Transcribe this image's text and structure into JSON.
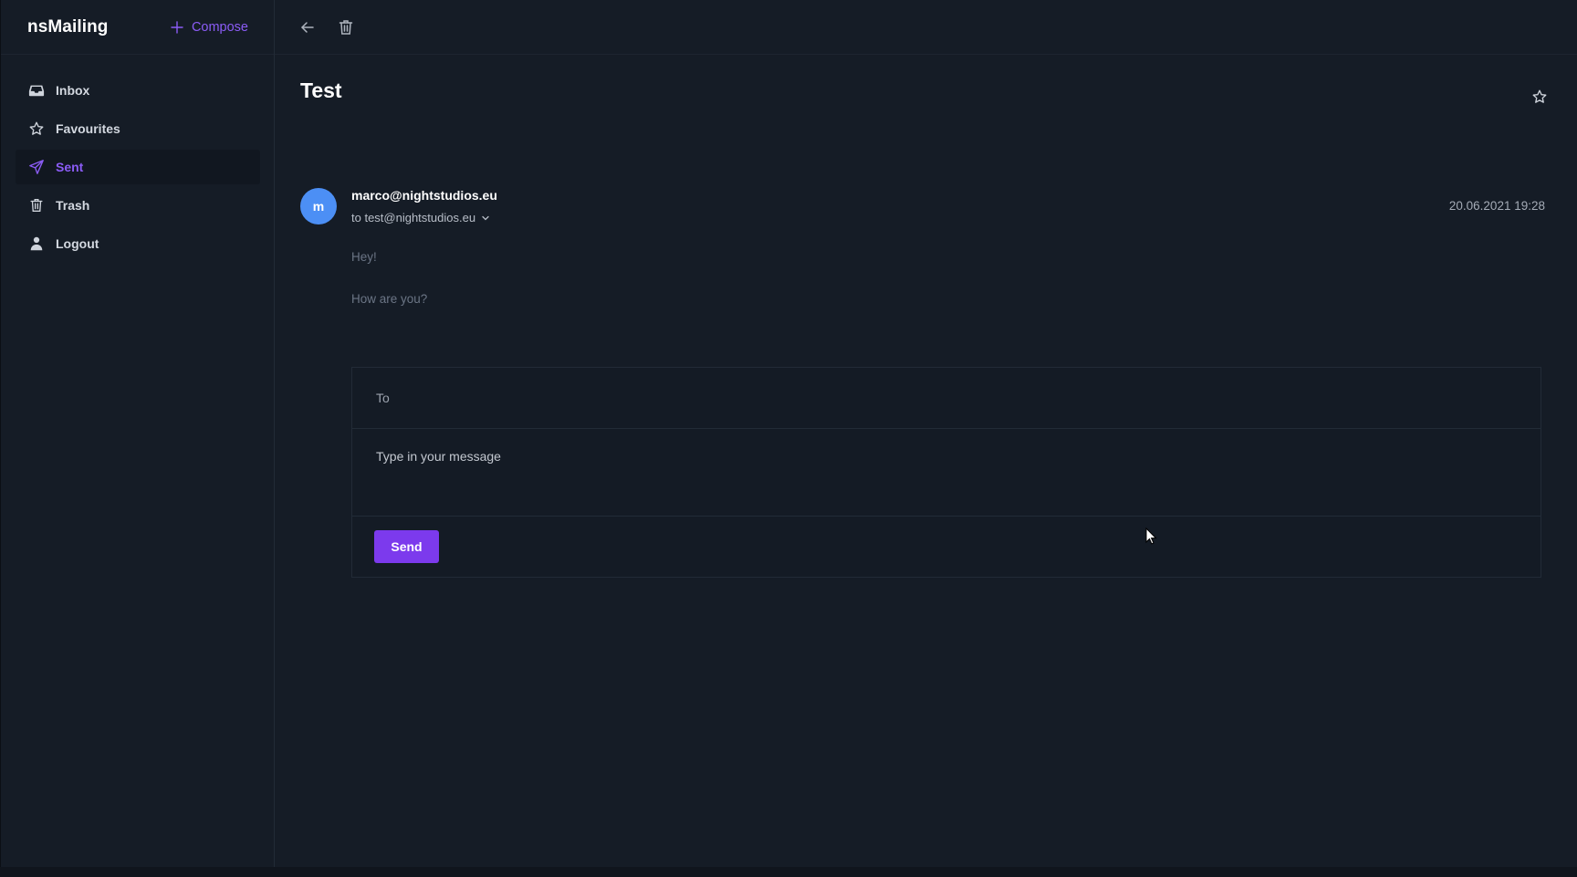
{
  "app": {
    "brand": "nsMailing",
    "compose_label": "Compose"
  },
  "sidebar": {
    "items": [
      {
        "label": "Inbox",
        "icon": "inbox-icon"
      },
      {
        "label": "Favourites",
        "icon": "star-icon"
      },
      {
        "label": "Sent",
        "icon": "send-icon",
        "active": true
      },
      {
        "label": "Trash",
        "icon": "trash-icon"
      },
      {
        "label": "Logout",
        "icon": "user-icon"
      }
    ]
  },
  "toolbar": {
    "back_icon": "arrow-left-icon",
    "delete_icon": "trash-icon"
  },
  "message": {
    "subject": "Test",
    "avatar_letter": "m",
    "from": "marco@nightstudios.eu",
    "to": "to test@nightstudios.eu",
    "date": "20.06.2021 19:28",
    "body": [
      "Hey!",
      "How are you?"
    ]
  },
  "reply": {
    "to_placeholder": "To",
    "message_placeholder": "Type in your message",
    "send_label": "Send"
  },
  "colors": {
    "background": "#151c26",
    "accent": "#8b5cf6",
    "send_button": "#7c3aed",
    "avatar": "#4c8ff5"
  }
}
